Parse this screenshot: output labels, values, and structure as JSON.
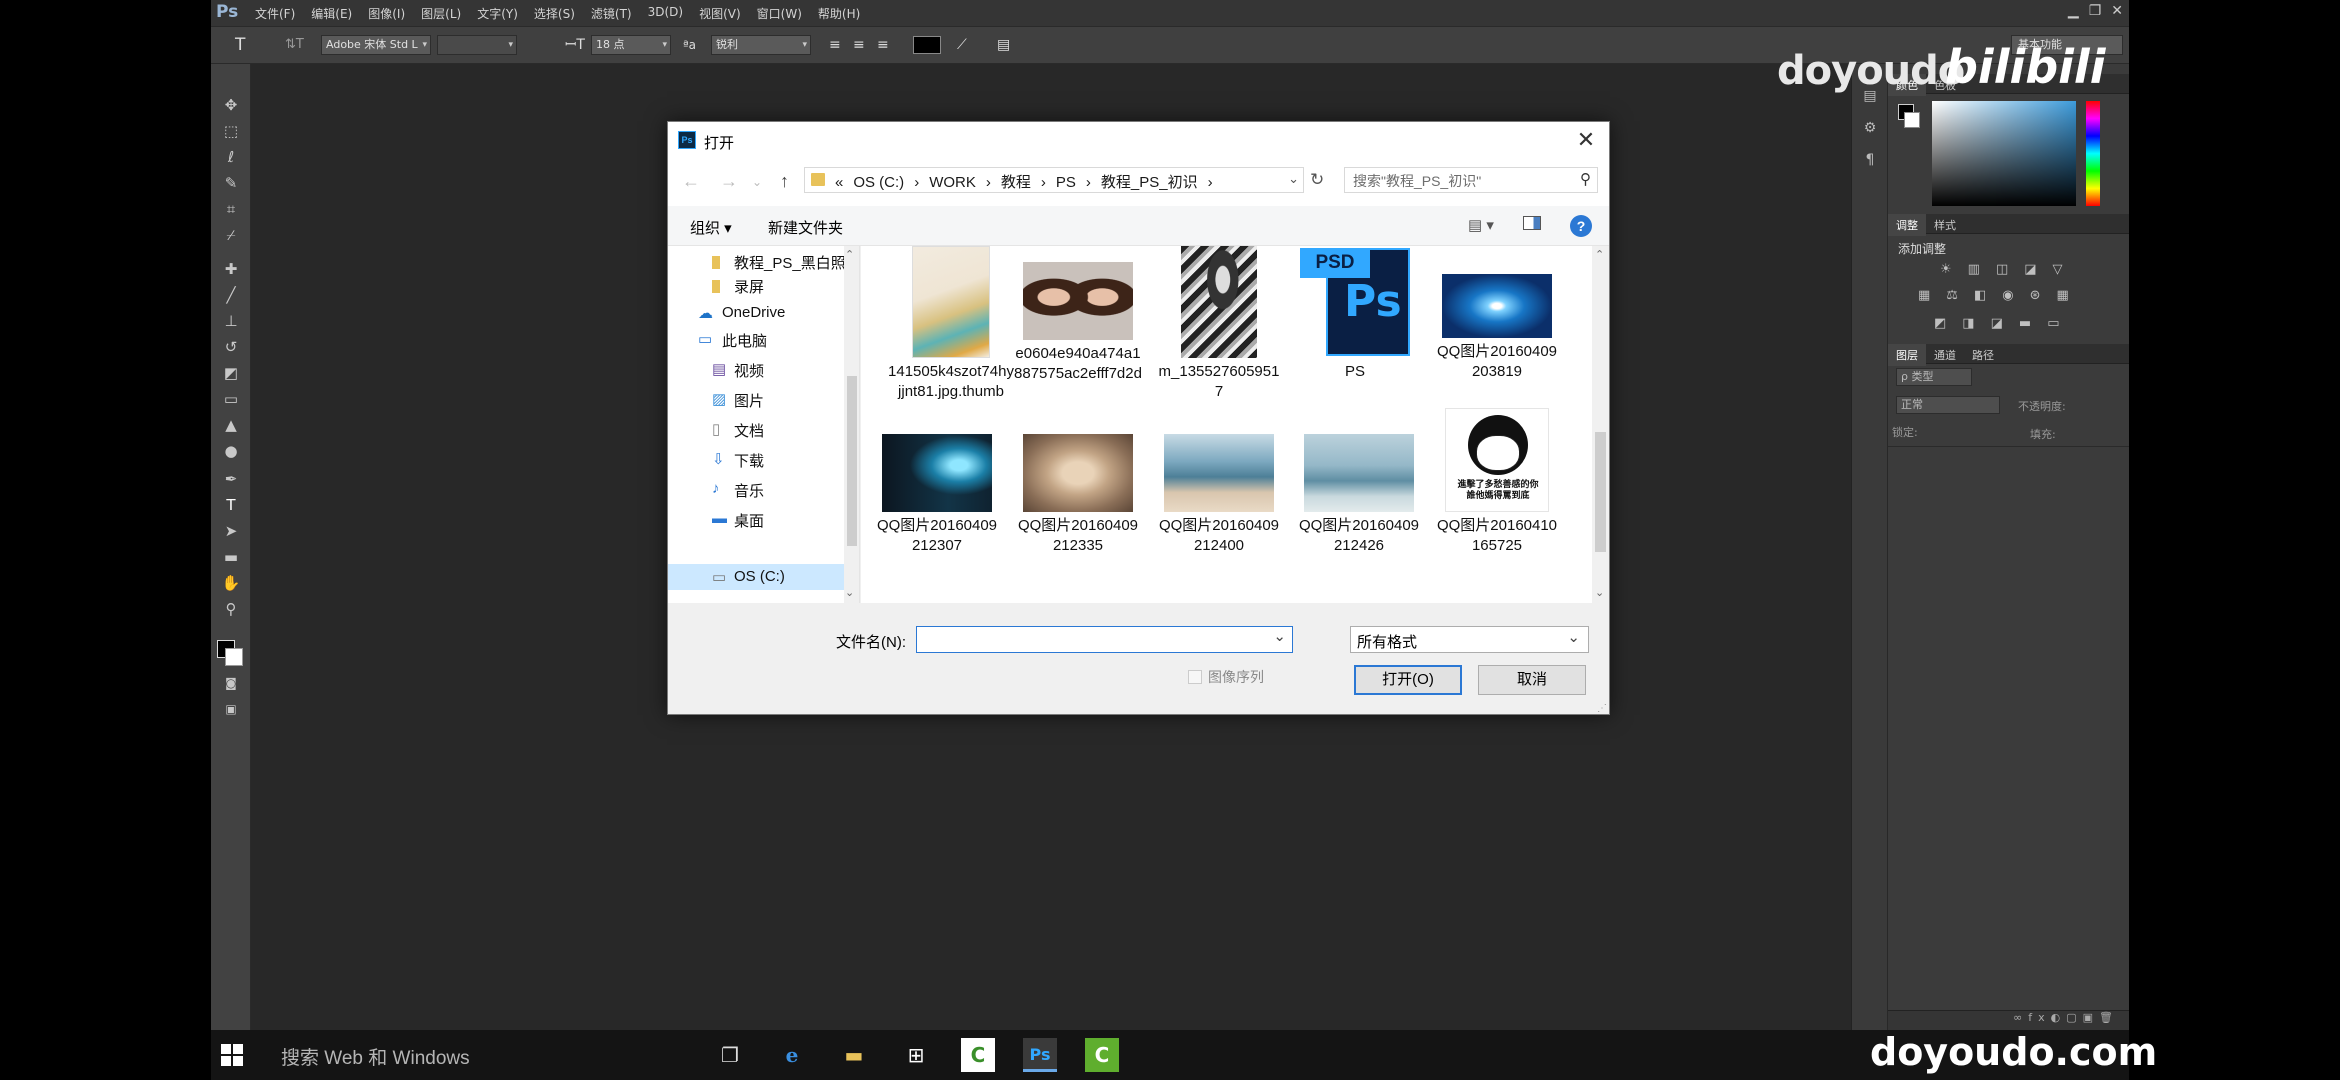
{
  "photoshop": {
    "logo": "Ps",
    "menus": [
      "文件(F)",
      "编辑(E)",
      "图像(I)",
      "图层(L)",
      "文字(Y)",
      "选择(S)",
      "滤镜(T)",
      "3D(D)",
      "视图(V)",
      "窗口(W)",
      "帮助(H)"
    ],
    "options": {
      "font_family": "Adobe 宋体 Std L",
      "font_size": "18 点",
      "antialias": "锐利",
      "workspace": "基本功能"
    },
    "panels": {
      "color_tabs": [
        "颜色",
        "色板"
      ],
      "adjust_tabs": [
        "调整",
        "样式"
      ],
      "add_adjustment": "添加调整",
      "layer_tabs": [
        "图层",
        "通道",
        "路径"
      ],
      "layer_kind": "ρ 类型",
      "blend_mode": "正常",
      "opacity_label": "不透明度:",
      "lock_label": "锁定:",
      "fill_label": "填充:"
    }
  },
  "watermark": {
    "top": "doyoudo",
    "brand": "bilibili",
    "bottom": "doyoudo.com"
  },
  "dialog": {
    "title": "打开",
    "breadcrumb": [
      "«",
      "OS (C:)",
      "›",
      "WORK",
      "›",
      "教程",
      "›",
      "PS",
      "›",
      "教程_PS_初识",
      "›"
    ],
    "search_placeholder": "搜索\"教程_PS_初识\"",
    "organize": "组织 ▾",
    "new_folder": "新建文件夹",
    "help": "?",
    "nav": [
      {
        "label": "教程_PS_黑白照"
      },
      {
        "label": "录屏"
      },
      {
        "label": "OneDrive"
      },
      {
        "label": "此电脑"
      },
      {
        "label": "视频"
      },
      {
        "label": "图片"
      },
      {
        "label": "文档"
      },
      {
        "label": "下载"
      },
      {
        "label": "音乐"
      },
      {
        "label": "桌面"
      },
      {
        "label": "OS (C:)"
      }
    ],
    "files": [
      {
        "name": "141505k4szot74hyjjnt81.jpg.thumb"
      },
      {
        "name": "e0604e940a474a1887575ac2efff7d2d"
      },
      {
        "name": "m_1355276059517"
      },
      {
        "name": "PS"
      },
      {
        "name": "QQ图片20160409203819"
      },
      {
        "name": "QQ图片20160409212307"
      },
      {
        "name": "QQ图片20160409212335"
      },
      {
        "name": "QQ图片20160409212400"
      },
      {
        "name": "QQ图片20160409212426"
      },
      {
        "name": "QQ图片20160410165725"
      }
    ],
    "psd_badge": "PSD",
    "ps_mark": "Ps",
    "meme_text": "進擊了多愁善感的你\n誰他媽得罵到底",
    "filename_label": "文件名(N):",
    "filename_value": "",
    "format": "所有格式",
    "image_sequence": "图像序列",
    "open_button": "打开(O)",
    "cancel_button": "取消"
  },
  "taskbar": {
    "search_text": "搜索 Web 和 Windows"
  }
}
